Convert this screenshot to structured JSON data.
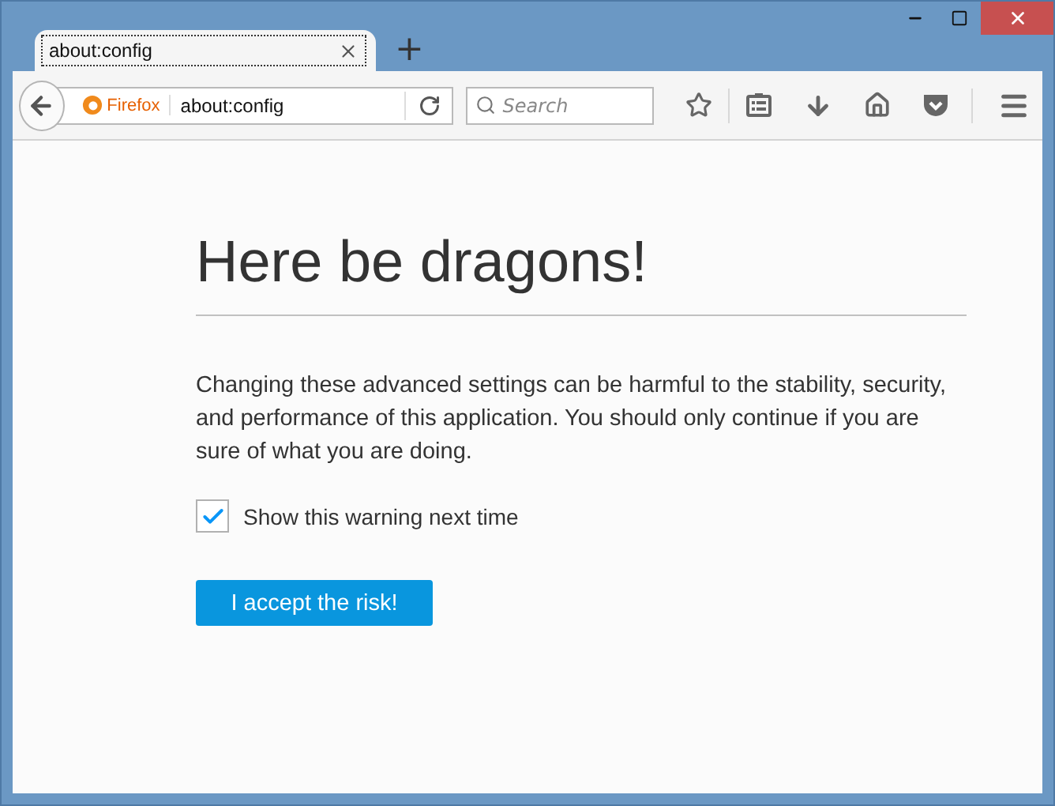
{
  "tabs": [
    {
      "label": "about:config",
      "selected": true
    }
  ],
  "new_tab": "+",
  "address_bar": {
    "identity": "Firefox",
    "url": "about:config"
  },
  "search": {
    "placeholder": "Search"
  },
  "page": {
    "heading": "Here be dragons!",
    "warning": "Changing these advanced settings can be harmful to the stability, security, and performance of this application. You should only continue if you are sure of what you are doing.",
    "checkbox": {
      "label": "Show this warning next time",
      "checked": true
    },
    "button": "I accept the risk!"
  }
}
